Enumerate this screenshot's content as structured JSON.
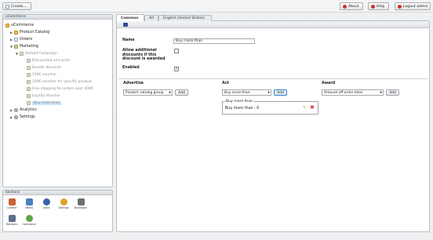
{
  "toolbar": {
    "create_label": "Create...",
    "about_label": "About",
    "help_label": "Help",
    "logout_label": "Logout admin"
  },
  "tree_panel": {
    "title": "uCommerce",
    "items": [
      {
        "label": "uCommerce"
      },
      {
        "label": "Product Catalog"
      },
      {
        "label": "Orders"
      },
      {
        "label": "Marketing"
      },
      {
        "label": "Default Campaign"
      },
      {
        "label": "Discounted unit price"
      },
      {
        "label": "Bundle discount"
      },
      {
        "label": "100€ voucher"
      },
      {
        "label": "100€ voucher for specific product"
      },
      {
        "label": "Free shipping for orders over 400€"
      },
      {
        "label": "Loyalty Voucher"
      },
      {
        "label": "Buy more than"
      },
      {
        "label": "Analytics"
      },
      {
        "label": "Settings"
      }
    ]
  },
  "sections_panel": {
    "title": "Sections",
    "items": [
      {
        "label": "Content",
        "icon": "content-icon",
        "color": "#c9623a"
      },
      {
        "label": "Media",
        "icon": "media-icon",
        "color": "#4c7fbf"
      },
      {
        "label": "Users",
        "icon": "users-icon",
        "color": "#3a5fa8"
      },
      {
        "label": "Settings",
        "icon": "settings-icon",
        "color": "#d9a324"
      },
      {
        "label": "Developer",
        "icon": "developer-icon",
        "color": "#6e6e6e"
      },
      {
        "label": "Members",
        "icon": "members-icon",
        "color": "#5a6f8a"
      },
      {
        "label": "Commerce",
        "icon": "commerce-icon",
        "color": "#5ea845"
      }
    ]
  },
  "tabs": [
    {
      "label": "Common"
    },
    {
      "label": "Ad"
    },
    {
      "label": "English (United States)"
    }
  ],
  "form": {
    "name_label": "Name",
    "name_value": "Buy more than",
    "allow_label": "Allow additional discounts if this discount is awarded",
    "allow_checked": false,
    "enabled_label": "Enabled",
    "enabled_checked": true,
    "check_mark": "✓"
  },
  "columns": {
    "advertise": "Advertise",
    "act": "Act",
    "award": "Award"
  },
  "advertise_select": "Product catalog group",
  "act_select": "Buy more than",
  "award_select": "Amount off order total",
  "add_label": "Add",
  "act_box": {
    "title": "Buy more than",
    "text": "Buy more than : 0"
  },
  "colors": {
    "accent": "#3c83c6",
    "delete": "#d2312b",
    "edit": "#d9a324"
  }
}
